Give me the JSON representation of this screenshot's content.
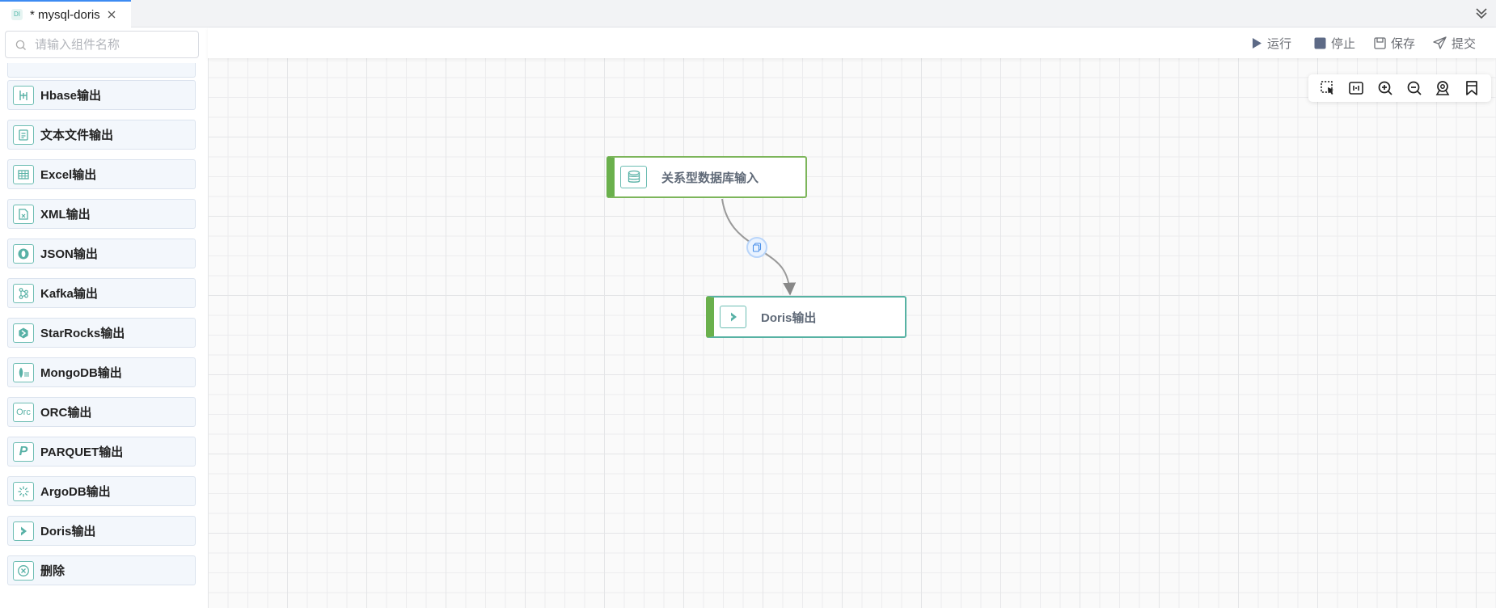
{
  "tab": {
    "badge": "DI",
    "title": "* mysql-doris"
  },
  "sidebar": {
    "search_placeholder": "请输入组件名称",
    "components": [
      {
        "label": "Hbase输出",
        "icon": "hbase-icon"
      },
      {
        "label": "文本文件输出",
        "icon": "text-file-icon"
      },
      {
        "label": "Excel输出",
        "icon": "excel-table-icon"
      },
      {
        "label": "XML输出",
        "icon": "xml-file-icon"
      },
      {
        "label": "JSON输出",
        "icon": "json-icon"
      },
      {
        "label": "Kafka输出",
        "icon": "kafka-icon"
      },
      {
        "label": "StarRocks输出",
        "icon": "starrocks-icon"
      },
      {
        "label": "MongoDB输出",
        "icon": "mongodb-icon"
      },
      {
        "label": "ORC输出",
        "icon": "orc-icon"
      },
      {
        "label": "PARQUET输出",
        "icon": "parquet-icon"
      },
      {
        "label": "ArgoDB输出",
        "icon": "argodb-icon"
      },
      {
        "label": "Doris输出",
        "icon": "doris-icon"
      },
      {
        "label": "删除",
        "icon": "delete-icon"
      }
    ],
    "orc_icon_text": "Orc",
    "parquet_icon_text": "P"
  },
  "toolbar": {
    "run": "运行",
    "stop": "停止",
    "save": "保存",
    "submit": "提交"
  },
  "canvas": {
    "nodes": [
      {
        "label": "关系型数据库输入",
        "icon": "database-icon"
      },
      {
        "label": "Doris输出",
        "icon": "doris-icon"
      }
    ],
    "tools": [
      "box-select-icon",
      "fit-view-icon",
      "zoom-in-icon",
      "zoom-out-icon",
      "locate-icon",
      "bookmark-icon"
    ]
  },
  "colors": {
    "accent": "#3d8bf2",
    "node_bar": "#6ab04c",
    "icon_teal": "#58b1a6"
  }
}
